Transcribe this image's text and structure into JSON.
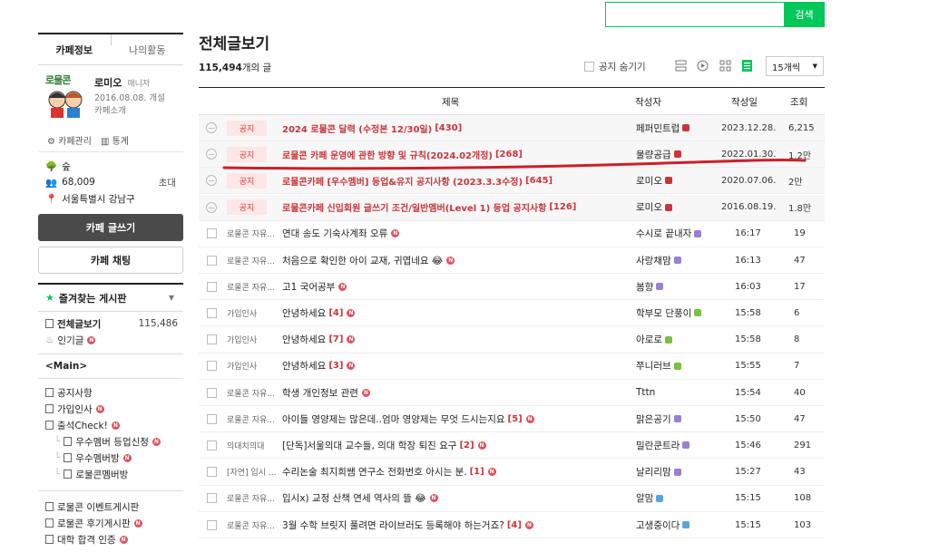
{
  "search": {
    "placeholder": "",
    "button": "검색"
  },
  "sidebar": {
    "tabs": [
      "카페정보",
      "나의활동"
    ],
    "logo_text": "로물콘",
    "manager_name": "로미오",
    "manager_role": "매니저",
    "founded": "2016.08.08. 개설",
    "intro_link": "카페소개",
    "manage_link": "카페관리",
    "stats_link": "통계",
    "level": "숲",
    "members": "68,009",
    "invite": "초대",
    "location": "서울특별시 강남구",
    "write_button": "카페 글쓰기",
    "chat_button": "카페 채팅",
    "favorites_title": "즐겨찾는 게시판",
    "all_posts": "전체글보기",
    "all_posts_count": "115,486",
    "popular": "인기글",
    "group_main": "<Main>",
    "menu": [
      {
        "label": "공지사항",
        "indent": false,
        "new": false
      },
      {
        "label": "가입인사",
        "indent": false,
        "new": true
      },
      {
        "label": "출석Check!",
        "indent": false,
        "new": true
      },
      {
        "label": "우수멤버 등업신청",
        "indent": true,
        "new": true
      },
      {
        "label": "우수멤버방",
        "indent": true,
        "new": true
      },
      {
        "label": "로물콘멤버방",
        "indent": true,
        "new": false
      }
    ],
    "menu2": [
      {
        "label": "로물콘 이벤트게시판",
        "new": false
      },
      {
        "label": "로물콘 후기게시판",
        "new": true
      },
      {
        "label": "대학 합격 인증",
        "new": true
      }
    ]
  },
  "main": {
    "title": "전체글보기",
    "count_num": "115,494",
    "count_suffix": "개의 글",
    "hide_notice": "공지 숨기기",
    "per_page": "15개씩",
    "headers": {
      "title": "제목",
      "author": "작성자",
      "date": "작성일",
      "views": "조회"
    },
    "notice_tag": "공지",
    "notices": [
      {
        "title": "2024 로물콘 달력 (수정본 12/30일)",
        "comments": "[430]",
        "author": "페퍼민트럽",
        "date": "2023.12.28.",
        "views": "6,215"
      },
      {
        "title": "로물콘 카페 운영에 관한 방향 및 규칙(2024.02개정)",
        "comments": "[268]",
        "author": "물량공급",
        "date": "2022.01.30.",
        "views": "1.2만"
      },
      {
        "title": "로물콘카페 [우수멤버] 등업&유지 공지사항 (2023.3.3수정)",
        "comments": "[645]",
        "author": "로미오",
        "date": "2020.07.06.",
        "views": "2만"
      },
      {
        "title": "로물콘카페 신입회원 글쓰기 조건/일반멤버(Level 1) 등업 공지사항",
        "comments": "[126]",
        "author": "로미오",
        "date": "2016.08.19.",
        "views": "1.8만"
      }
    ],
    "posts": [
      {
        "cat": "로물콘 자유...",
        "title": "연대 송도 기숙사계좌 오류",
        "comments": "",
        "author": "수시로 끝내자",
        "lv": "#9b7fd4",
        "date": "16:17",
        "views": "19"
      },
      {
        "cat": "로물콘 자유...",
        "title": "처음으로 확인한 아이 교재, 귀엽네요 😂",
        "comments": "",
        "author": "사랑채맘",
        "lv": "#9b7fd4",
        "date": "16:13",
        "views": "47"
      },
      {
        "cat": "로물콘 자유...",
        "title": "고1 국어공부",
        "comments": "",
        "author": "봄향",
        "lv": "#9b7fd4",
        "date": "16:03",
        "views": "17"
      },
      {
        "cat": "가입인사",
        "title": "안녕하세요",
        "comments": "[4]",
        "author": "학부모 단풍이",
        "lv": "#7bc043",
        "date": "15:58",
        "views": "6"
      },
      {
        "cat": "가입인사",
        "title": "안녕하세요",
        "comments": "[7]",
        "author": "아로로",
        "lv": "#7bc043",
        "date": "15:58",
        "views": "8"
      },
      {
        "cat": "가입인사",
        "title": "안녕하세요",
        "comments": "[3]",
        "author": "쭈니러브",
        "lv": "#7bc043",
        "date": "15:55",
        "views": "7"
      },
      {
        "cat": "로물콘 자유...",
        "title": "학생 개인정보 관련",
        "comments": "",
        "author": "Tttn",
        "lv": "",
        "date": "15:54",
        "views": "40"
      },
      {
        "cat": "로물콘 자유...",
        "title": "아이들 영양제는 많은데..엄마 영양제는 무엇 드시는지요",
        "comments": "[5]",
        "author": "맑은공기",
        "lv": "#9b7fd4",
        "date": "15:50",
        "views": "47"
      },
      {
        "cat": "의대치의대",
        "title": "[단독]서울의대 교수들, 의대 학장 퇴진 요구",
        "comments": "[2]",
        "author": "밀란쿤트라",
        "lv": "#9b7fd4",
        "date": "15:46",
        "views": "291"
      },
      {
        "cat": "[자연] 입시 ...",
        "title": "수리논술 최지희쌤 연구소 전화번호 아시는 분.",
        "comments": "[1]",
        "author": "날리리맘",
        "lv": "#9b7fd4",
        "date": "15:27",
        "views": "43"
      },
      {
        "cat": "로물콘 자유...",
        "title": "입시x) 교정 산책 연세 역사의 뜰 😂",
        "comments": "",
        "author": "알맘",
        "lv": "#5ba3e0",
        "date": "15:15",
        "views": "108"
      },
      {
        "cat": "로물콘 자유...",
        "title": "3월 수학 브릿지 풀려면 라이브러도 등록해야 하는거죠?",
        "comments": "[4]",
        "author": "고생중이다",
        "lv": "#5ba3e0",
        "date": "15:15",
        "views": "103"
      }
    ],
    "colors": {
      "accent": "#03c75a",
      "notice": "#c8363c",
      "annotation": "#cc1f2a"
    }
  }
}
